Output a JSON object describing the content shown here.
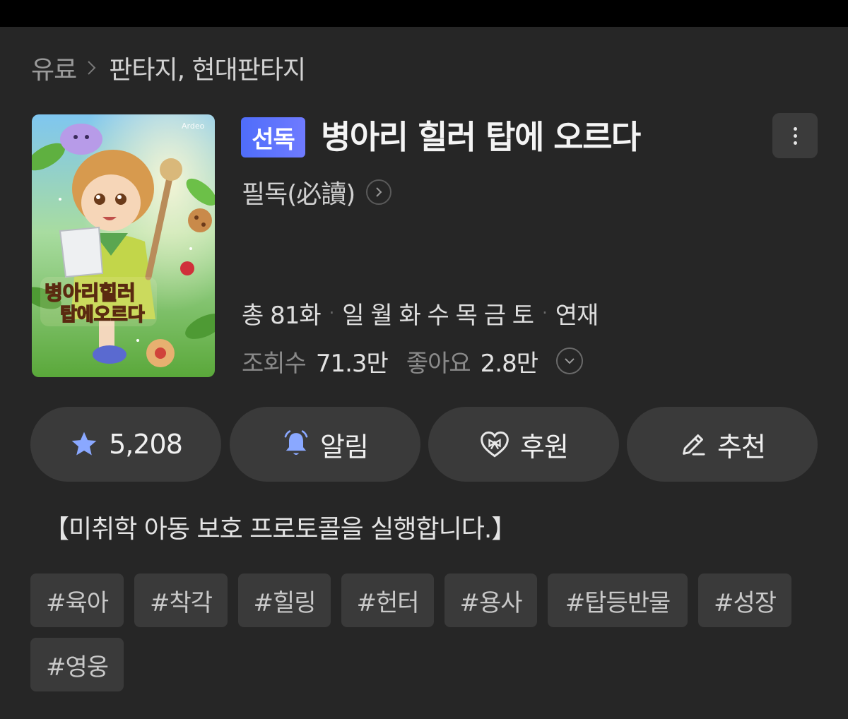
{
  "breadcrumb": {
    "category": "유료",
    "genres": "판타지, 현대판타지"
  },
  "novel": {
    "badge": "선독",
    "title": "병아리 힐러 탑에 오르다",
    "author": "필독(必讀)",
    "cover_alt": "병아리 힐러 탑에 오르다 cover art"
  },
  "meta": {
    "total_episodes": "총 81화",
    "schedule_days": "일 월 화 수 목 금 토",
    "status": "연재",
    "separator": "·"
  },
  "stats": {
    "views_label": "조회수",
    "views_value": "71.3만",
    "likes_label": "좋아요",
    "likes_value": "2.8만"
  },
  "actions": {
    "favorite_count": "5,208",
    "alarm_label": "알림",
    "support_label": "후원",
    "recommend_label": "추천"
  },
  "synopsis": "【미취학 아동 보호 프로토콜을 실행합니다.】",
  "tags": [
    "#육아",
    "#착각",
    "#힐링",
    "#헌터",
    "#용사",
    "#탑등반물",
    "#성장",
    "#영웅"
  ],
  "colors": {
    "background": "#262626",
    "button_bg": "#3a3a3a",
    "badge_gradient_start": "#4f6dfa",
    "badge_gradient_end": "#6f7bff",
    "icon_accent": "#8aa8ff"
  },
  "icons": {
    "breadcrumb_separator": "chevron-right-icon",
    "more": "more-vertical-icon",
    "author_link": "chevron-right-circle-icon",
    "expand_stats": "chevron-down-circle-icon",
    "favorite": "star-icon",
    "alarm": "bell-icon",
    "support": "heart-ribbon-icon",
    "recommend": "pencil-icon"
  }
}
